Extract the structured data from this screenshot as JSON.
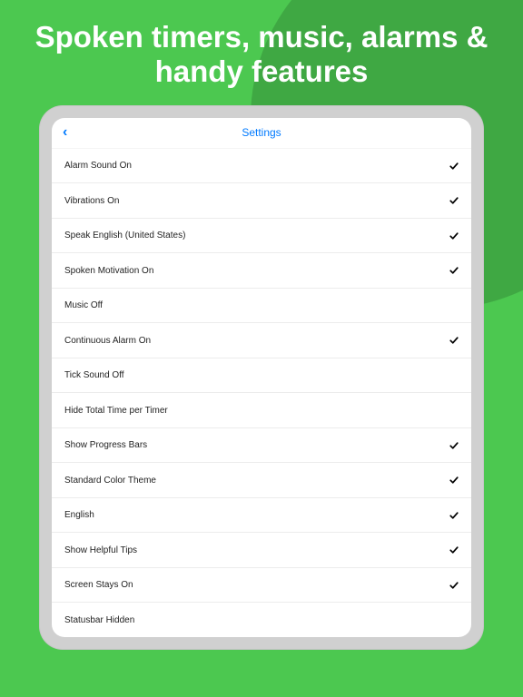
{
  "headline": "Spoken timers, music, alarms & handy features",
  "nav": {
    "title": "Settings",
    "back_glyph": "‹"
  },
  "settings": [
    {
      "label": "Alarm Sound On",
      "checked": true
    },
    {
      "label": "Vibrations On",
      "checked": true
    },
    {
      "label": "Speak English (United States)",
      "checked": true
    },
    {
      "label": "Spoken Motivation On",
      "checked": true
    },
    {
      "label": "Music Off",
      "checked": false
    },
    {
      "label": "Continuous Alarm On",
      "checked": true
    },
    {
      "label": "Tick Sound Off",
      "checked": false
    },
    {
      "label": "Hide Total Time per Timer",
      "checked": false
    },
    {
      "label": "Show Progress Bars",
      "checked": true
    },
    {
      "label": "Standard Color Theme",
      "checked": true
    },
    {
      "label": "English",
      "checked": true
    },
    {
      "label": "Show Helpful Tips",
      "checked": true
    },
    {
      "label": "Screen Stays On",
      "checked": true
    },
    {
      "label": "Statusbar Hidden",
      "checked": false
    }
  ]
}
